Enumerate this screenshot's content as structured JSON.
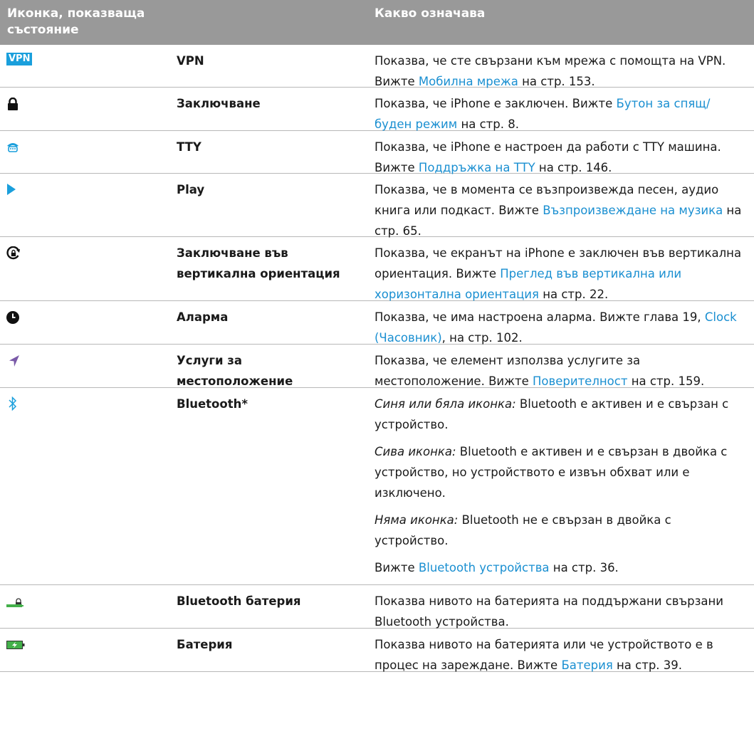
{
  "header": {
    "col_icon": "Иконка, показваща състояние",
    "col_meaning": "Какво означава"
  },
  "colors": {
    "header_bg": "#999999",
    "link": "#1a8fd1",
    "icon_blue": "#1a9fdc",
    "icon_purple": "#7a5aa8",
    "battery_green": "#43b04a"
  },
  "rows": [
    {
      "icon": "vpn-icon",
      "icon_text": "VPN",
      "name": "VPN",
      "d1": "Показва, че сте свързани към мрежа с помощта на VPN. Вижте ",
      "link": "Мобилна мрежа",
      "d2": " на стр. 153."
    },
    {
      "icon": "lock-icon",
      "name": "Заключване",
      "d1": "Показва, че iPhone е заключен. Вижте ",
      "link": "Бутон за спящ/буден режим",
      "d2": " на стр. 8."
    },
    {
      "icon": "tty-icon",
      "name": "TTY",
      "d1": "Показва, че iPhone е настроен да работи с TTY машина. Вижте ",
      "link": "Поддръжка на TTY",
      "d2": " на стр. 146."
    },
    {
      "icon": "play-icon",
      "name": "Play",
      "d1": "Показва, че в момента се възпроизвежда песен, аудио книга или подкаст. Вижте ",
      "link": "Възпроизвеждане на музика",
      "d2": " на стр. 65."
    },
    {
      "icon": "orientation-lock-icon",
      "name": "Заключване във вертикална ориентация",
      "d1": "Показва, че екранът на iPhone е заключен във вертикална ориентация. Вижте ",
      "link": "Преглед във вертикална или хоризонтална ориентация",
      "d2": " на стр. 22."
    },
    {
      "icon": "alarm-icon",
      "name": "Аларма",
      "d1": "Показва, че има настроена аларма. Вижте глава 19, ",
      "link": "Clock (Часовник)",
      "d2": ", на стр. 102."
    },
    {
      "icon": "location-arrow-icon",
      "name": "Услуги за местоположение",
      "d1": "Показва, че елемент използва услугите за местоположение. Вижте ",
      "link": "Поверителност",
      "d2": " на стр. 159."
    },
    {
      "icon": "bluetooth-icon",
      "name": "Bluetooth*",
      "p1_em": "Синя или бяла иконка:",
      "p1": "  Bluetooth е активен и е свързан с устройство.",
      "p2_em": "Сива иконка:",
      "p2": "  Bluetooth е активен и е свързан в двойка с устройство, но устройството е извън обхват или е изключено.",
      "p3_em": "Няма иконка:",
      "p3": "  Bluetooth не е свързан в двойка с устройство.",
      "p4": "Вижте ",
      "link": "Bluetooth устройства",
      "p4_end": " на стр. 36."
    },
    {
      "icon": "bluetooth-battery-icon",
      "name": "Bluetooth батерия",
      "d1": "Показва нивото на батерията на поддържани свързани Bluetooth устройства."
    },
    {
      "icon": "battery-charging-icon",
      "name": "Батерия",
      "d1": "Показва нивото на батерията или че устройството е в процес на зареждане. Вижте ",
      "link": "Батерия",
      "d2": " на стр. 39."
    }
  ]
}
